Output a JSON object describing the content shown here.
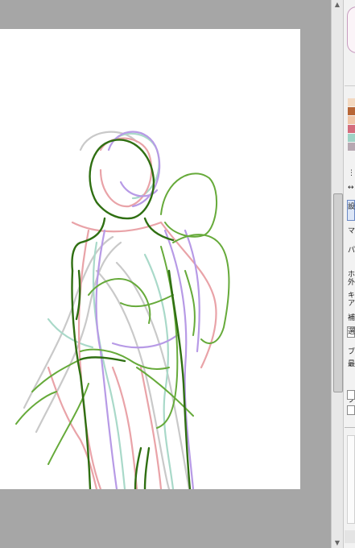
{
  "canvas": {
    "paper_color": "#ffffff",
    "background_color": "#a6a6a6",
    "layers": [
      {
        "name": "purple-sketch",
        "color": "#b79ae6"
      },
      {
        "name": "pink-sketch",
        "color": "#e9a3a8"
      },
      {
        "name": "teal-sketch",
        "color": "#a9d9c9"
      },
      {
        "name": "gray-sketch",
        "color": "#c9c9c9"
      },
      {
        "name": "light-green-sketch",
        "color": "#66aa3a"
      },
      {
        "name": "dark-green-sketch",
        "color": "#2f6f12"
      }
    ]
  },
  "palette": {
    "colors": [
      "#f3d9c1",
      "#b86636",
      "#f0c6a8",
      "#d46c7c",
      "#9fd3c6",
      "#b7a8b2"
    ]
  },
  "panel": {
    "labels": [
      "⋮",
      "↔",
      "設",
      "マ",
      "パ",
      "ホ",
      "外",
      "キ",
      "ア",
      "補",
      "選",
      "ブ",
      "最",
      "ブ"
    ]
  }
}
